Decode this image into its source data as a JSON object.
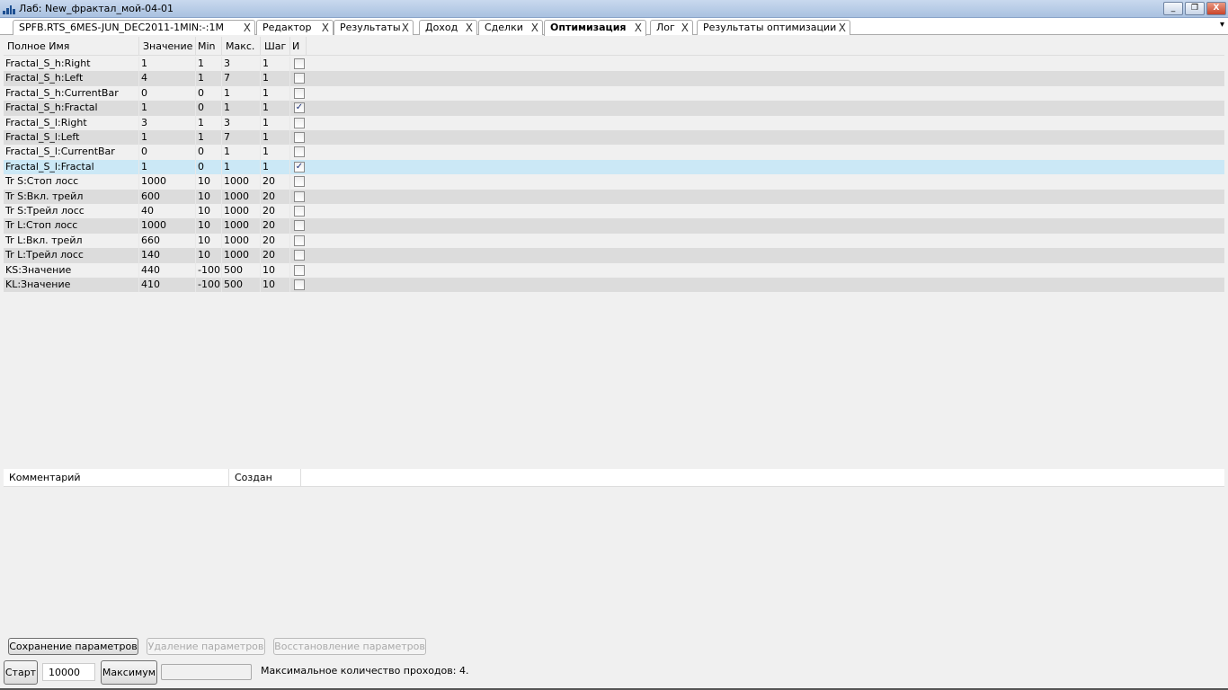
{
  "window": {
    "title": "Лаб: New_фрактал_мой-04-01",
    "buttons": [
      "_",
      "❐",
      "X"
    ]
  },
  "tabs": [
    {
      "label": "SPFB.RTS_6MES-JUN_DEC2011-1MIN:-:1M",
      "active": false
    },
    {
      "label": "Редактор",
      "active": false
    },
    {
      "label": "Результаты",
      "active": false
    },
    {
      "label": "Доход",
      "active": false
    },
    {
      "label": "Сделки",
      "active": false
    },
    {
      "label": "Оптимизация",
      "active": true
    },
    {
      "label": "Лог",
      "active": false
    },
    {
      "label": "Результаты оптимизации",
      "active": false
    }
  ],
  "tab_close": "X",
  "overflow_icon": "▾",
  "params": {
    "columns": [
      "Полное Имя",
      "Значение",
      "Min",
      "Макс.",
      "Шаг",
      "И"
    ],
    "rows": [
      {
        "name": "Fractal_S_h:Right",
        "value": "1",
        "min": "1",
        "max": "3",
        "step": "1",
        "checked": false
      },
      {
        "name": "Fractal_S_h:Left",
        "value": "4",
        "min": "1",
        "max": "7",
        "step": "1",
        "checked": false
      },
      {
        "name": "Fractal_S_h:CurrentBar",
        "value": "0",
        "min": "0",
        "max": "1",
        "step": "1",
        "checked": false
      },
      {
        "name": "Fractal_S_h:Fractal",
        "value": "1",
        "min": "0",
        "max": "1",
        "step": "1",
        "checked": true
      },
      {
        "name": "Fractal_S_l:Right",
        "value": "3",
        "min": "1",
        "max": "3",
        "step": "1",
        "checked": false
      },
      {
        "name": "Fractal_S_l:Left",
        "value": "1",
        "min": "1",
        "max": "7",
        "step": "1",
        "checked": false
      },
      {
        "name": "Fractal_S_l:CurrentBar",
        "value": "0",
        "min": "0",
        "max": "1",
        "step": "1",
        "checked": false
      },
      {
        "name": "Fractal_S_l:Fractal",
        "value": "1",
        "min": "0",
        "max": "1",
        "step": "1",
        "checked": true,
        "selected": true
      },
      {
        "name": "Tr S:Стоп лосс",
        "value": "1000",
        "min": "10",
        "max": "1000",
        "step": "20",
        "checked": false
      },
      {
        "name": "Tr S:Вкл. трейл",
        "value": "600",
        "min": "10",
        "max": "1000",
        "step": "20",
        "checked": false
      },
      {
        "name": "Tr S:Трейл лосс",
        "value": "40",
        "min": "10",
        "max": "1000",
        "step": "20",
        "checked": false
      },
      {
        "name": "Tr L:Стоп лосс",
        "value": "1000",
        "min": "10",
        "max": "1000",
        "step": "20",
        "checked": false
      },
      {
        "name": "Tr L:Вкл. трейл",
        "value": "660",
        "min": "10",
        "max": "1000",
        "step": "20",
        "checked": false
      },
      {
        "name": "Tr L:Трейл лосс",
        "value": "140",
        "min": "10",
        "max": "1000",
        "step": "20",
        "checked": false
      },
      {
        "name": "KS:Значение",
        "value": "440",
        "min": "-100",
        "max": "500",
        "step": "10",
        "checked": false
      },
      {
        "name": "KL:Значение",
        "value": "410",
        "min": "-100",
        "max": "500",
        "step": "10",
        "checked": false
      }
    ]
  },
  "saved": {
    "columns": [
      "Комментарий",
      "Создан"
    ]
  },
  "buttons": {
    "save": "Сохранение параметров",
    "delete": "Удаление параметров",
    "restore": "Восстановление параметров",
    "start": "Старт",
    "max": "Максимум"
  },
  "iterations": "10000",
  "progress": 0,
  "status": "Максимальное количество проходов: 4."
}
